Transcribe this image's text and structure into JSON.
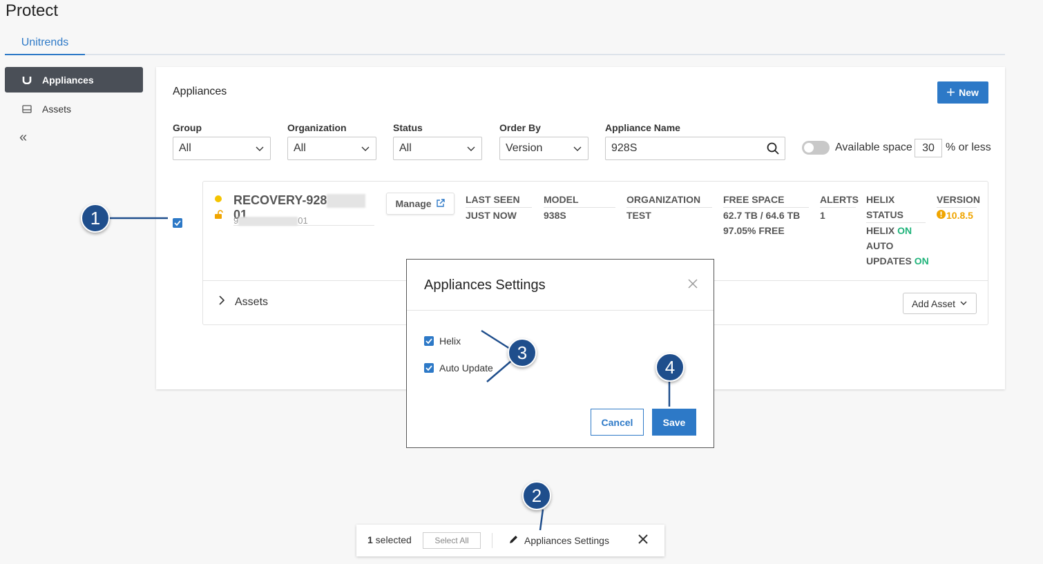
{
  "page": {
    "title": "Protect",
    "tab": "Unitrends"
  },
  "sidebar": {
    "items": [
      {
        "label": "Appliances",
        "icon": "unitrends-logo-icon"
      },
      {
        "label": "Assets",
        "icon": "drive-icon"
      }
    ],
    "collapse_glyph": "«"
  },
  "card": {
    "title": "Appliances",
    "new_label": "New"
  },
  "filters": {
    "group": {
      "label": "Group",
      "value": "All"
    },
    "organization": {
      "label": "Organization",
      "value": "All"
    },
    "status": {
      "label": "Status",
      "value": "All"
    },
    "order_by": {
      "label": "Order By",
      "value": "Version"
    },
    "appliance_name": {
      "label": "Appliance Name",
      "value": "928S"
    },
    "available_space": {
      "label": "Available space",
      "value": "30",
      "suffix": "% or less"
    }
  },
  "appliance": {
    "name_prefix": "RECOVERY-928",
    "name_suffix": "01",
    "sub_prefix": "9",
    "sub_suffix": "01",
    "manage_label": "Manage",
    "columns": {
      "last_seen": {
        "header": "LAST SEEN",
        "value": "JUST NOW"
      },
      "model": {
        "header": "MODEL",
        "value": "938S"
      },
      "organization": {
        "header": "ORGANIZATION",
        "value": "TEST"
      },
      "free_space": {
        "header": "FREE SPACE",
        "value1": "62.7 TB / 64.6 TB",
        "value2": "97.05% FREE"
      },
      "alerts": {
        "header": "ALERTS",
        "value": "1"
      },
      "helix_status": {
        "header1": "HELIX",
        "header2": "STATUS",
        "helix": "HELIX",
        "helix_state": "ON",
        "auto1": "AUTO",
        "auto2": "UPDATES",
        "auto_state": "ON"
      },
      "version": {
        "header": "VERSION",
        "value": "10.8.5"
      }
    },
    "assets_label": "Assets",
    "add_asset_label": "Add Asset"
  },
  "modal": {
    "title": "Appliances Settings",
    "options": [
      {
        "label": "Helix",
        "checked": true
      },
      {
        "label": "Auto Update",
        "checked": true
      }
    ],
    "cancel_label": "Cancel",
    "save_label": "Save"
  },
  "selection_bar": {
    "count": "1",
    "count_suffix": " selected",
    "select_all_label": "Select All",
    "settings_label": "Appliances Settings"
  },
  "callouts": [
    "1",
    "2",
    "3",
    "4"
  ],
  "colors": {
    "accent": "#2d79c7",
    "sidebar_active": "#4a4f57",
    "callout": "#1f4e8c",
    "on": "#1fb37a",
    "warning": "#f0a500",
    "status_dot": "#f5c400"
  }
}
